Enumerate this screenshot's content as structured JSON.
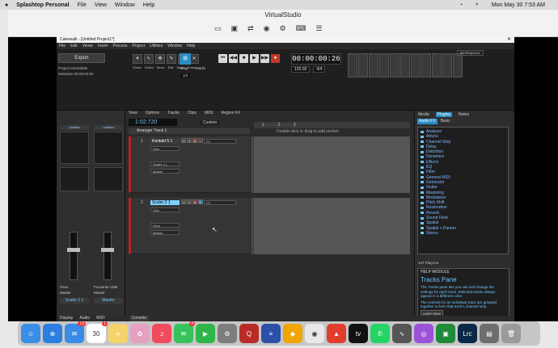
{
  "mac": {
    "app": "Splashtop Personal",
    "menus": [
      "File",
      "View",
      "Window",
      "Help"
    ],
    "clock": "Mon May 30  7:53 AM"
  },
  "vs": {
    "title": "VirtualStudio"
  },
  "app": {
    "title": "Cakewalk - [Untitled Project1*]",
    "menu": [
      "File",
      "Edit",
      "Views",
      "Insert",
      "Process",
      "Project",
      "Utilities",
      "Window",
      "Help"
    ],
    "export": "Export",
    "options": [
      "Project  Immediate",
      "Selection  00:00:00:00"
    ],
    "tools": [
      "Smart",
      "Select",
      "Move",
      "Edit",
      "Draw",
      "Erase"
    ],
    "snap": "Snap",
    "marks": "Marks",
    "snap_val": "1/4",
    "time": "00:00:00:26",
    "tempo": "120.00",
    "meter": "4/4",
    "workspace": "Workspaces"
  },
  "tracks": {
    "header": [
      "View",
      "Options",
      "Tracks",
      "Clips",
      "MIDI",
      "Region FX"
    ],
    "clock": "1:02:720",
    "arranger": "Arranger Track 1",
    "custom": "Custom",
    "dblclick": "Double-click or drag to add section",
    "list": [
      {
        "num": "1",
        "name": "Kontakt 5 1",
        "input": "Olox",
        "aux": "Scaler 2 (...",
        "out": "Master",
        "fx": "FX",
        "selected": false
      },
      {
        "num": "2",
        "name": "Scaler 2 1",
        "input": "Olox",
        "aux": "Oxxx",
        "out": "Master",
        "fx": "FX",
        "selected": true
      }
    ]
  },
  "strips": {
    "a": {
      "name": "Untitled",
      "label": "Scaler 2 1",
      "io": "Oxxx",
      "out": "Master"
    },
    "b": {
      "name": "Untitled",
      "label": "Master",
      "io": "Focusrite USB",
      "out": "Master"
    }
  },
  "browser": {
    "tabs": [
      "Media",
      "Plugins",
      "Notes"
    ],
    "sub": [
      "Audio FX",
      "Basic"
    ],
    "items": [
      "Analyzer",
      "Arturia",
      "Channel Strip",
      "Delay",
      "Distortion",
      "Dynamics",
      "Effects",
      "EQ",
      "Filter",
      "General MIDI",
      "Generator",
      "Guitar",
      "Mastering",
      "Modulation",
      "Pitch Shift",
      "Restoration",
      "Reverb",
      "Sound Field",
      "Spatial",
      "Spatial + Panner",
      "Stereo"
    ],
    "count": "147 Plug-ins"
  },
  "help": {
    "header": "HELP MODULE",
    "title": "Tracks Pane",
    "p1": "The Tracks pane lets you see and change the settings for each track. Selected tracks always appear in a different color.",
    "p2": "The controls for an individual track are grouped together to form that track's channel strip.",
    "learn": "Learn More"
  },
  "bottom": [
    "Display",
    "Audio",
    "MIDI",
    "Console"
  ],
  "dock": [
    {
      "name": "finder",
      "color": "#3a8ee6",
      "label": "☺"
    },
    {
      "name": "safari",
      "color": "#2a7fe0",
      "label": "⊕"
    },
    {
      "name": "mail",
      "color": "#3a8be5",
      "label": "✉",
      "badge": "13"
    },
    {
      "name": "calendar",
      "color": "#ffffff",
      "label": "30",
      "badge": "1"
    },
    {
      "name": "notes",
      "color": "#f5d36b",
      "label": "≡"
    },
    {
      "name": "photos",
      "color": "#e6a0c0",
      "label": "✿"
    },
    {
      "name": "music",
      "color": "#f04a5d",
      "label": "♫"
    },
    {
      "name": "messages",
      "color": "#36c35a",
      "label": "✉",
      "badge": "4"
    },
    {
      "name": "facetime",
      "color": "#2fb64a",
      "label": "▶"
    },
    {
      "name": "system-preferences",
      "color": "#7d7d7d",
      "label": "⚙"
    },
    {
      "name": "quora",
      "color": "#b92b27",
      "label": "Q"
    },
    {
      "name": "vpn",
      "color": "#2c4fa8",
      "label": "≡"
    },
    {
      "name": "sketch",
      "color": "#f0a500",
      "label": "◆"
    },
    {
      "name": "chrome",
      "color": "#e8e8e8",
      "label": "◉"
    },
    {
      "name": "pdf",
      "color": "#e03d2d",
      "label": "▲"
    },
    {
      "name": "appletv",
      "color": "#111111",
      "label": "tv"
    },
    {
      "name": "whatsapp",
      "color": "#25d366",
      "label": "✆"
    },
    {
      "name": "audio",
      "color": "#555555",
      "label": "∿"
    },
    {
      "name": "podcasts",
      "color": "#9b52d9",
      "label": "◎"
    },
    {
      "name": "ibooks",
      "color": "#1e8b3a",
      "label": "▣"
    },
    {
      "name": "lightroom",
      "color": "#0a2847",
      "label": "Lrc"
    },
    {
      "name": "preview",
      "color": "#6e6e6e",
      "label": "▤"
    },
    {
      "name": "trash",
      "color": "#9a9a9a",
      "label": "🗑"
    }
  ]
}
